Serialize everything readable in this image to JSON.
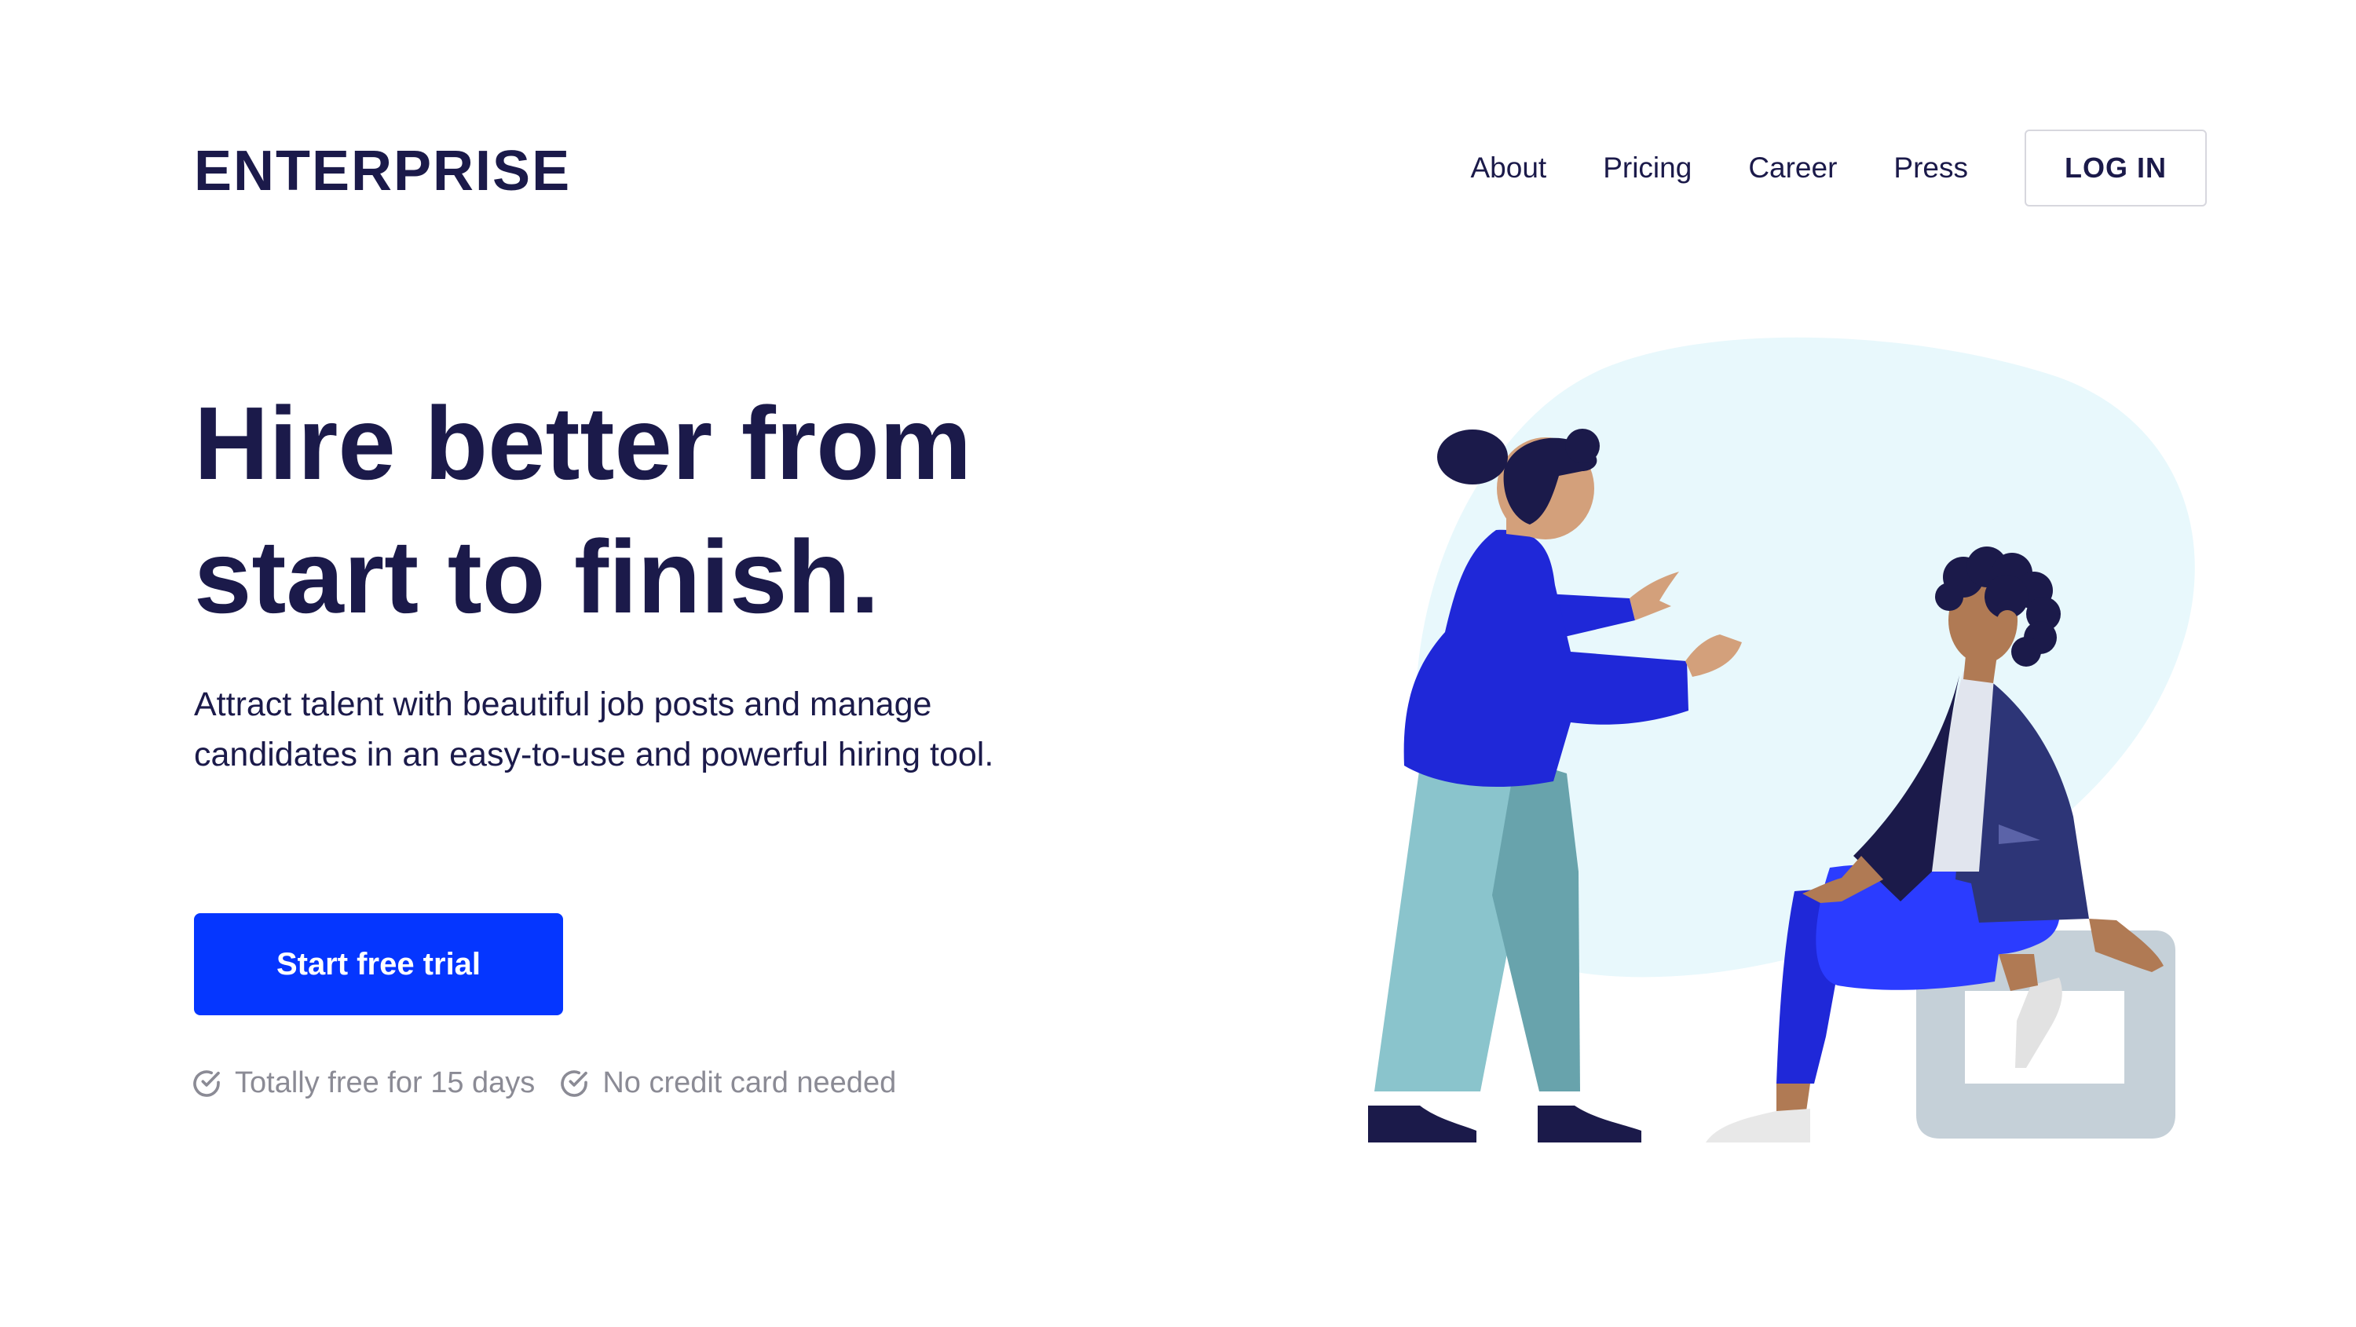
{
  "header": {
    "logo": "ENTERPRISE",
    "nav": [
      {
        "label": "About"
      },
      {
        "label": "Pricing"
      },
      {
        "label": "Career"
      },
      {
        "label": "Press"
      }
    ],
    "login_label": "LOG IN"
  },
  "hero": {
    "headline_line1": "Hire better from",
    "headline_line2": "start to finish.",
    "subtitle": "Attract talent with beautiful job posts and manage candidates in an easy-to-use and powerful hiring tool.",
    "cta_label": "Start free trial",
    "notes": [
      {
        "icon": "check-circle-icon",
        "text": "Totally free for 15 days"
      },
      {
        "icon": "check-circle-icon",
        "text": "No credit card needed"
      }
    ]
  },
  "illustration": {
    "name": "hiring-conversation-illustration",
    "colors": {
      "blob": "#e8f8fc",
      "primary_blue": "#1f28d8",
      "navy": "#1b1a4a",
      "skin": "#d3a07b",
      "skin_dark": "#b07a54",
      "pants_light": "#8ac4cc",
      "pants_dark": "#68a3ac",
      "jacket": "#2d3577",
      "stool": "#c5d0d8"
    }
  },
  "theme": {
    "accent": "#0536ff",
    "text": "#1b1a4a",
    "muted": "#8b8b95"
  }
}
